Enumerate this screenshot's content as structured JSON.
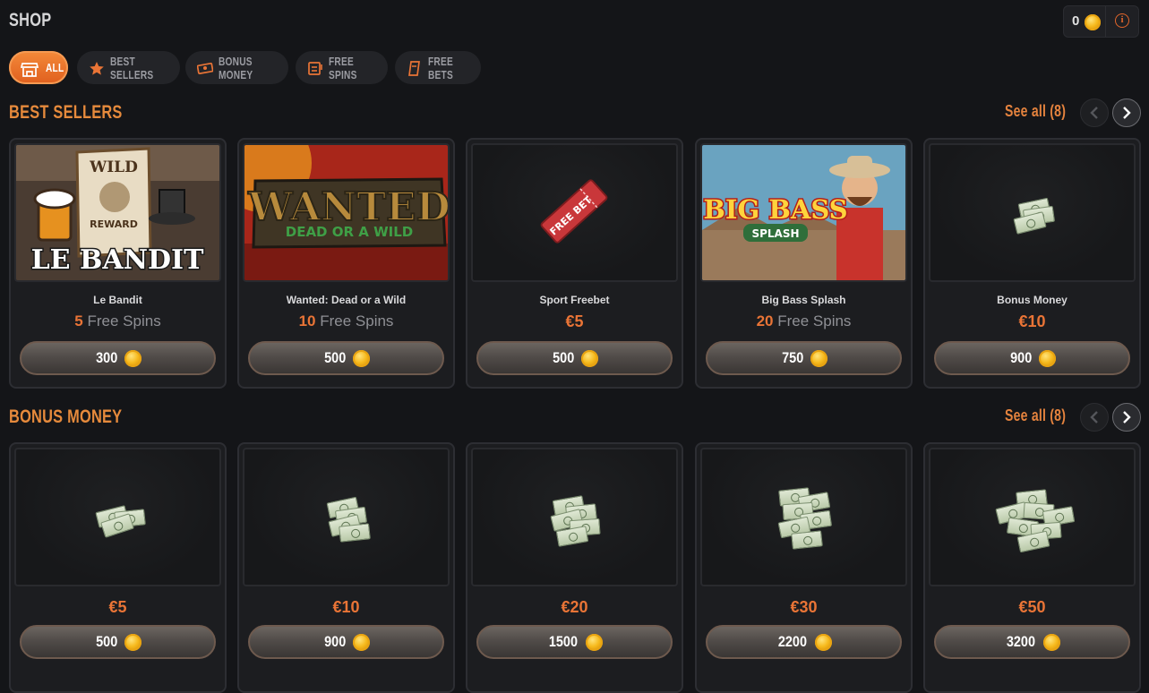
{
  "header": {
    "title": "SHOP",
    "balance": "0",
    "info_icon": "info-icon"
  },
  "tabs": [
    {
      "label": "ALL",
      "icon": "store-icon",
      "active": true
    },
    {
      "label": "BEST SELLERS",
      "icon": "star-icon",
      "active": false
    },
    {
      "label": "BONUS MONEY",
      "icon": "cash-icon",
      "active": false
    },
    {
      "label": "FREE SPINS",
      "icon": "slot-icon",
      "active": false
    },
    {
      "label": "FREE BETS",
      "icon": "ticket-icon",
      "active": false
    }
  ],
  "sections": [
    {
      "title": "BEST SELLERS",
      "see_all": "See all (8)",
      "items": [
        {
          "name": "Le Bandit",
          "amount": "5",
          "unit": "Free Spins",
          "price": "300",
          "image": "le-bandit-art",
          "art_lines": [
            "WILD",
            "REWARD",
            "LE BANDIT"
          ]
        },
        {
          "name": "Wanted: Dead or a Wild",
          "amount": "10",
          "unit": "Free Spins",
          "price": "500",
          "image": "wanted-art",
          "art_lines": [
            "WANTED",
            "DEAD OR A WILD"
          ]
        },
        {
          "name": "Sport Freebet",
          "amount": "€5",
          "unit": "",
          "price": "500",
          "image": "free-bet-ticket",
          "art_lines": [
            "FREE BET"
          ]
        },
        {
          "name": "Big Bass Splash",
          "amount": "20",
          "unit": "Free Spins",
          "price": "750",
          "image": "big-bass-art",
          "art_lines": [
            "BIG BASS",
            "SPLASH"
          ]
        },
        {
          "name": "Bonus Money",
          "amount": "€10",
          "unit": "",
          "price": "900",
          "image": "cash-stack",
          "art_lines": []
        }
      ]
    },
    {
      "title": "BONUS MONEY",
      "see_all": "See all (8)",
      "items": [
        {
          "amount": "€5",
          "price": "500",
          "image": "cash-stack-small"
        },
        {
          "amount": "€10",
          "price": "900",
          "image": "cash-stack"
        },
        {
          "amount": "€20",
          "price": "1500",
          "image": "cash-stack-medium"
        },
        {
          "amount": "€30",
          "price": "2200",
          "image": "cash-stack-large"
        },
        {
          "amount": "€50",
          "price": "3200",
          "image": "cash-pile"
        }
      ]
    }
  ],
  "colors": {
    "accent": "#e97436",
    "background": "#141518",
    "card": "#1c1d20"
  }
}
